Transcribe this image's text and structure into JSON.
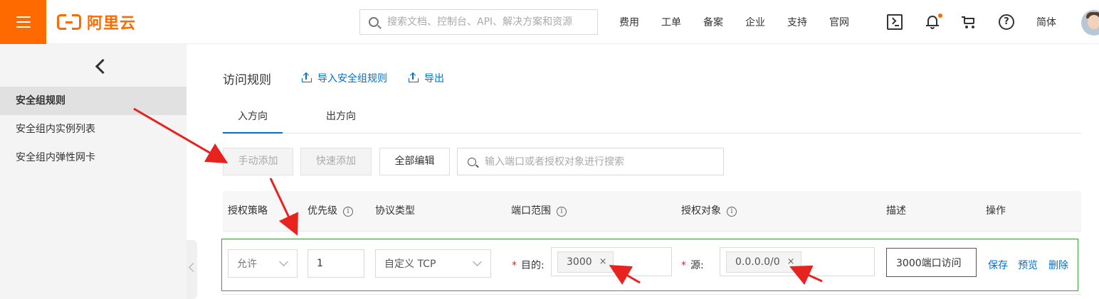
{
  "header": {
    "brand": "阿里云",
    "search_placeholder": "搜索文档、控制台、API、解决方案和资源",
    "nav": [
      "费用",
      "工单",
      "备案",
      "企业",
      "支持",
      "官网"
    ],
    "help_glyph": "?",
    "language": "简体"
  },
  "sidebar": {
    "items": [
      "安全组规则",
      "安全组内实例列表",
      "安全组内弹性网卡"
    ]
  },
  "page": {
    "title": "访问规则",
    "import_label": "导入安全组规则",
    "export_label": "导出"
  },
  "tabs": [
    "入方向",
    "出方向"
  ],
  "toolbar": {
    "manual_add": "手动添加",
    "quick_add": "快速添加",
    "edit_all": "全部编辑",
    "search_placeholder": "输入端口或者授权对象进行搜索"
  },
  "table": {
    "columns": [
      "授权策略",
      "优先级",
      "协议类型",
      "端口范围",
      "授权对象",
      "描述",
      "操作"
    ],
    "info_glyph": "i"
  },
  "edit_row": {
    "policy": "允许",
    "priority": "1",
    "protocol": "自定义 TCP",
    "required_mark": "*",
    "dest_label": "目的:",
    "dest_tag": "3000",
    "source_label": "源:",
    "source_tag": "0.0.0.0/0",
    "tag_close": "×",
    "description": "3000端口访问",
    "actions": [
      "保存",
      "预览",
      "删除"
    ]
  },
  "colors": {
    "brand": "#ff6a00",
    "link": "#0070cc",
    "row_border": "#3b9e3b",
    "annotation": "#e8231f"
  }
}
